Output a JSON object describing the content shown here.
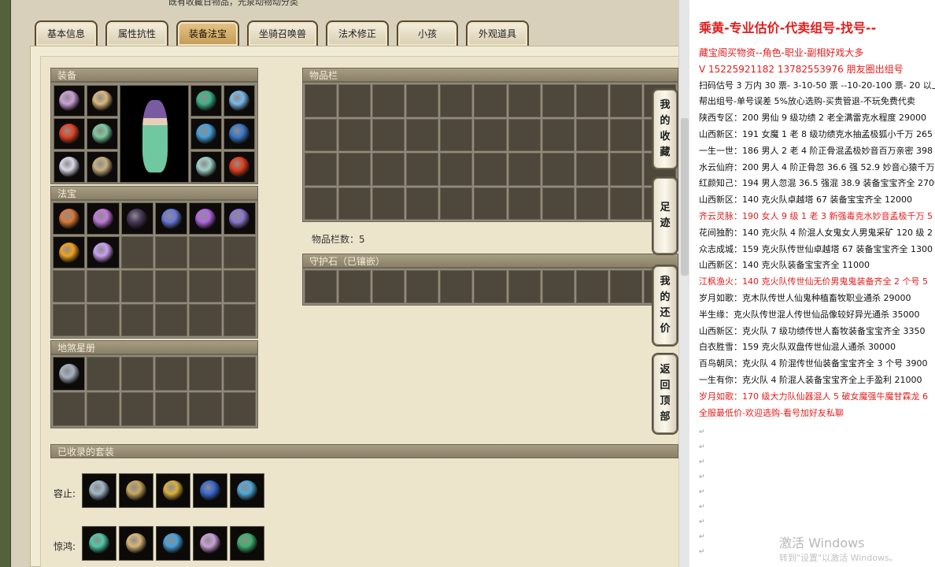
{
  "top_text": "既有收藏日物品，光泉动物动分类",
  "tabs": [
    "基本信息",
    "属性抗性",
    "装备法宝",
    "坐骑召唤兽",
    "法术修正",
    "小孩",
    "外观道具"
  ],
  "active_tab": 2,
  "sections": {
    "equipment": "装备",
    "fabao": "法宝",
    "dishaxing": "地煞星册",
    "inventory": "物品栏",
    "inventory_count": "物品栏数：5",
    "guardian": "守护石（已镶嵌）",
    "suits": "已收录的套装"
  },
  "suits": [
    {
      "label": "容止:"
    },
    {
      "label": "惊鸿:"
    }
  ],
  "side_buttons": [
    {
      "label": "我的收藏",
      "chars": [
        "我",
        "的",
        "收",
        "藏"
      ]
    },
    {
      "label": "足迹",
      "chars": [
        "足",
        "迹"
      ]
    },
    {
      "label": "我的还价",
      "chars": [
        "我",
        "的",
        "还",
        "价"
      ]
    },
    {
      "label": "返回顶部",
      "chars": [
        "返",
        "回",
        "顶",
        "部"
      ]
    }
  ],
  "doc": {
    "title": "乘黄-专业估价-代卖组号-找号--",
    "lines": [
      {
        "text": "藏宝阁买物资--角色-职业-副相好戏大多",
        "red": true
      },
      {
        "text": "V 15225921182   13782553976 朋友圈出组号",
        "red": true
      },
      {
        "text": "扫码估号 3 万内 30 票- 3-10-50 票  --10-20-100 票- 20 以上",
        "red": false
      },
      {
        "text": "帮出组号-单号误差 5%放心选购-买贵管退-不玩免费代卖",
        "red": false
      },
      {
        "text": "陕西专区：200 男仙 9 级功绩 2 老全满雷克水程度 29000",
        "red": false
      },
      {
        "text": "山西新区：191 女魔 1 老 8 级功绩克水抽孟极狐小千万 265",
        "red": false
      },
      {
        "text": "一生一世：186 男人 2 老 4 阶正骨混孟极妙音百万亲密 398",
        "red": false
      },
      {
        "text": "水云仙府：200 男人 4 阶正骨忽 36.6 强 52.9 妙音心猿千万",
        "red": false
      },
      {
        "text": "红颜知己：194 男人忽混 36.5 强混 38.9 装备宝宝齐全 2700",
        "red": false
      },
      {
        "text": "山西新区：140 克火队卓越塔 67 装备宝宝齐全 12000",
        "red": false
      },
      {
        "text": "齐云灵脉：190 女人 9 级 1 老 3 新强毒克水妙音孟极千万 5",
        "red": true
      },
      {
        "text": "花间独酌：140 克火队 4 阶混人女鬼女人男鬼采矿 120 级 2",
        "red": false
      },
      {
        "text": "众志成城：159 克火队传世仙卓越塔 67 装备宝宝齐全 1300",
        "red": false
      },
      {
        "text": "山西新区：140 克火队装备宝宝齐全 11000",
        "red": false
      },
      {
        "text": "江枫渔火：140 克火队传世仙无价男鬼鬼装备齐全 2 个号 5",
        "red": true
      },
      {
        "text": "岁月如歌：克木队传世人仙鬼种植畜牧职业通杀 29000",
        "red": false
      },
      {
        "text": "半生缘：克火队传世混人传世仙品像较好异光通杀 35000",
        "red": false
      },
      {
        "text": "山西新区：克火队 7 级功绩传世人畜牧装备宝宝齐全 3350",
        "red": false
      },
      {
        "text": "白衣胜雪：159 克火队双盘传世仙混人通杀 30000",
        "red": false
      },
      {
        "text": "百鸟朝凤：克火队 4 阶混传世仙装备宝宝齐全 3 个号 3900",
        "red": false
      },
      {
        "text": "一生有你：克火队 4 阶混人装备宝宝齐全上手盈利 21000",
        "red": false
      },
      {
        "text": "岁月如歌：170 级大力队仙器混人 5 破女魔强牛魔甘霖龙 6",
        "red": true
      },
      {
        "text": "全服最低价-欢迎选购-看号加好友私聊",
        "red": true
      }
    ]
  },
  "watermark": "激活 Windows",
  "watermark_sub": "转到\"设置\"以激活 Windows。",
  "colors": {
    "accent_red": "#e21c1c",
    "active_tab": "#c39a55"
  },
  "icons": {
    "equipment": [
      "jellyfish-icon",
      "helmet-icon",
      "mask-icon",
      "necklace-icon",
      "flame-weapon-icon",
      "armor-icon",
      "ring-icon",
      "belt-icon",
      "orb-icon",
      "boots-icon",
      "bracelet-icon",
      "sun-token-icon"
    ],
    "fabao": [
      "fan-icon",
      "lantern-icon",
      "dark-orb-icon",
      "claw-icon",
      "rope-icon",
      "scroll-icon",
      "fire-lotus-icon",
      "spark-icon"
    ],
    "dishaxing": [
      "warrior-card-icon"
    ],
    "suits": [
      [
        "ghost-icon",
        "staff-icon",
        "gold-bowl-icon",
        "blue-gem-icon",
        "blue-mask-icon"
      ],
      [
        "jade-armor-icon",
        "helmet-icon",
        "ring-icon",
        "jellyfish-icon",
        "green-mask-icon"
      ]
    ]
  }
}
